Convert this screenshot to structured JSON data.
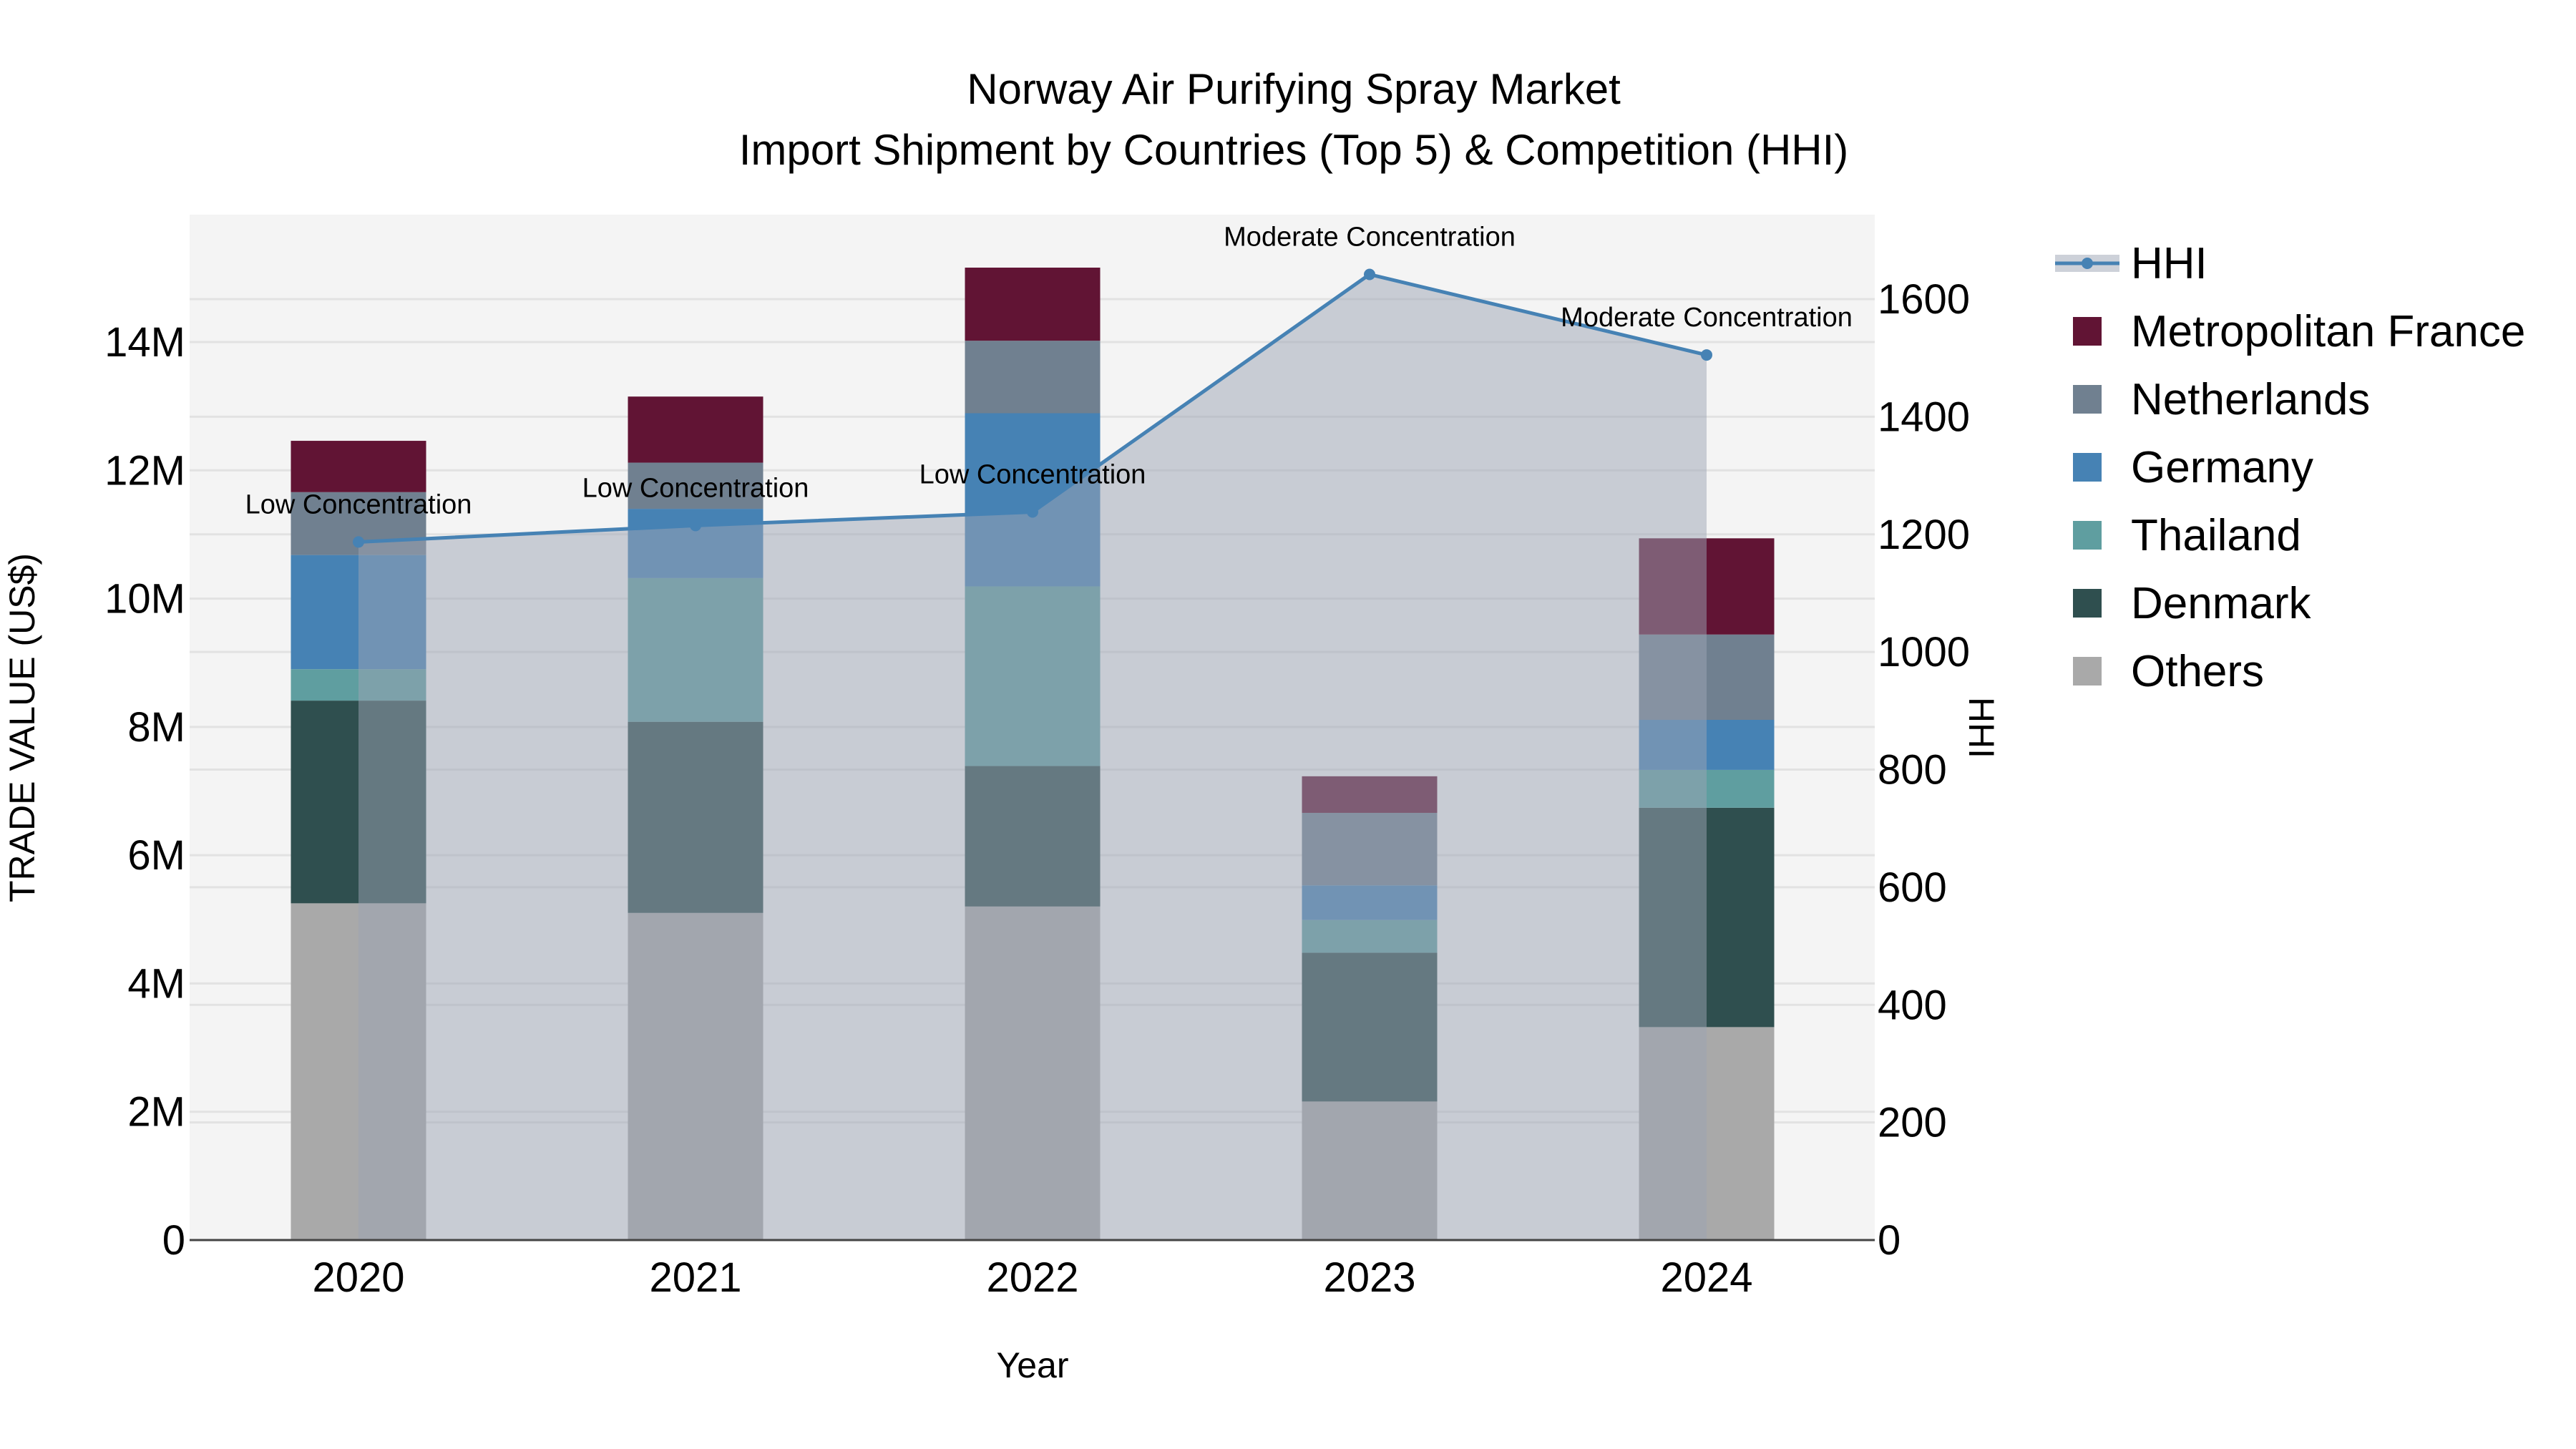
{
  "chart_data": {
    "type": "bar",
    "title": "Norway Air Purifying Spray Market",
    "subtitle": "Import Shipment by Countries (Top 5) & Competition (HHI)",
    "xlabel": "Year",
    "ylabel": "TRADE VALUE (US$)",
    "y2label": "HHI",
    "categories": [
      "2020",
      "2021",
      "2022",
      "2023",
      "2024"
    ],
    "ylim": [
      0,
      16000000
    ],
    "y_ticks": [
      0,
      2000000,
      4000000,
      6000000,
      8000000,
      10000000,
      12000000,
      14000000
    ],
    "y_tick_labels": [
      "0",
      "2M",
      "4M",
      "6M",
      "8M",
      "10M",
      "12M",
      "14M"
    ],
    "y2lim": [
      0,
      1750
    ],
    "y2_ticks": [
      0,
      200,
      400,
      600,
      800,
      1000,
      1200,
      1400,
      1600
    ],
    "y2_tick_labels": [
      "0",
      "200",
      "400",
      "600",
      "800",
      "1000",
      "1200",
      "1400",
      "1600"
    ],
    "grid": true,
    "legend_position": "right",
    "series": [
      {
        "name": "Others",
        "color": "#A9A9A9",
        "values": [
          5250000,
          5100000,
          5200000,
          2160000,
          3320000
        ]
      },
      {
        "name": "Denmark",
        "color": "#2F4F4F",
        "values": [
          3160000,
          2980000,
          2190000,
          2320000,
          3420000
        ]
      },
      {
        "name": "Thailand",
        "color": "#5F9EA0",
        "values": [
          490000,
          2240000,
          2800000,
          510000,
          590000
        ]
      },
      {
        "name": "Germany",
        "color": "#4682B4",
        "values": [
          1780000,
          1080000,
          2700000,
          540000,
          780000
        ]
      },
      {
        "name": "Netherlands",
        "color": "#708090",
        "values": [
          980000,
          720000,
          1130000,
          1130000,
          1330000
        ]
      },
      {
        "name": "Metropolitan France",
        "color": "#611434",
        "values": [
          800000,
          1030000,
          1140000,
          570000,
          1500000
        ]
      }
    ],
    "line": {
      "name": "HHI",
      "color": "#4682B4",
      "values": [
        1187,
        1215,
        1238,
        1642,
        1505
      ],
      "annotations": [
        "Low Concentration",
        "Low Concentration",
        "Low Concentration",
        "Moderate Concentration",
        "Moderate Concentration"
      ]
    },
    "legend_order": [
      "HHI",
      "Metropolitan France",
      "Netherlands",
      "Germany",
      "Thailand",
      "Denmark",
      "Others"
    ]
  }
}
